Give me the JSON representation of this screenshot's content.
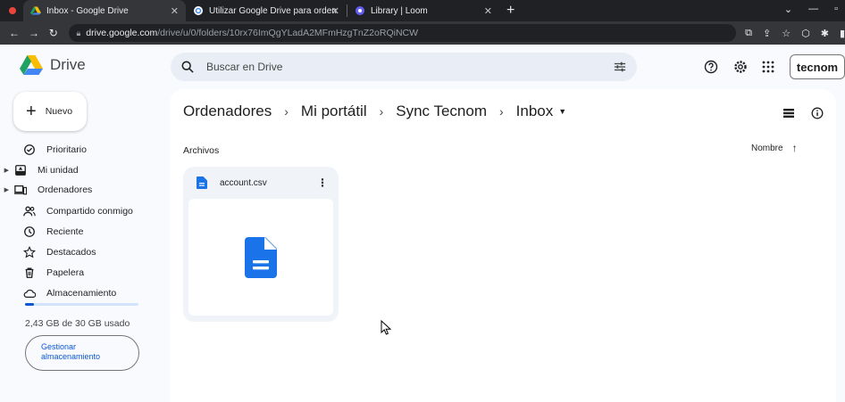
{
  "browser": {
    "tabs": [
      {
        "label": "Inbox - Google Drive",
        "active": true
      },
      {
        "label": "Utilizar Google Drive para orden",
        "active": false
      },
      {
        "label": "Library | Loom",
        "active": false
      }
    ],
    "new_tab": "+",
    "url_host": "drive.google.com",
    "url_path": "/drive/u/0/folders/10rx76ImQgYLadA2MFmHzgTnZ2oRQiNCW"
  },
  "app": {
    "name": "Drive",
    "search_placeholder": "Buscar en Drive",
    "account_label": "tecnom"
  },
  "sidebar": {
    "new_label": "Nuevo",
    "items": [
      {
        "label": "Prioritario",
        "icon": "check-circle-icon"
      },
      {
        "label": "Mi unidad",
        "icon": "my-drive-icon"
      },
      {
        "label": "Ordenadores",
        "icon": "computers-icon"
      },
      {
        "label": "Compartido conmigo",
        "icon": "shared-icon"
      },
      {
        "label": "Reciente",
        "icon": "clock-icon"
      },
      {
        "label": "Destacados",
        "icon": "star-icon"
      },
      {
        "label": "Papelera",
        "icon": "trash-icon"
      },
      {
        "label": "Almacenamiento",
        "icon": "cloud-icon"
      }
    ],
    "storage_fraction": 0.081,
    "storage_text": "2,43 GB de 30 GB usado",
    "manage_line1": "Gestionar",
    "manage_line2": "almacenamiento"
  },
  "main": {
    "breadcrumb": [
      "Ordenadores",
      "Mi portátil",
      "Sync Tecnom",
      "Inbox"
    ],
    "section_title": "Archivos",
    "sort_label": "Nombre",
    "files": [
      {
        "name": "account.csv"
      }
    ]
  },
  "colors": {
    "accent": "#0b57d0",
    "doc_blue": "#1a73e8",
    "background": "#f8fafd"
  }
}
